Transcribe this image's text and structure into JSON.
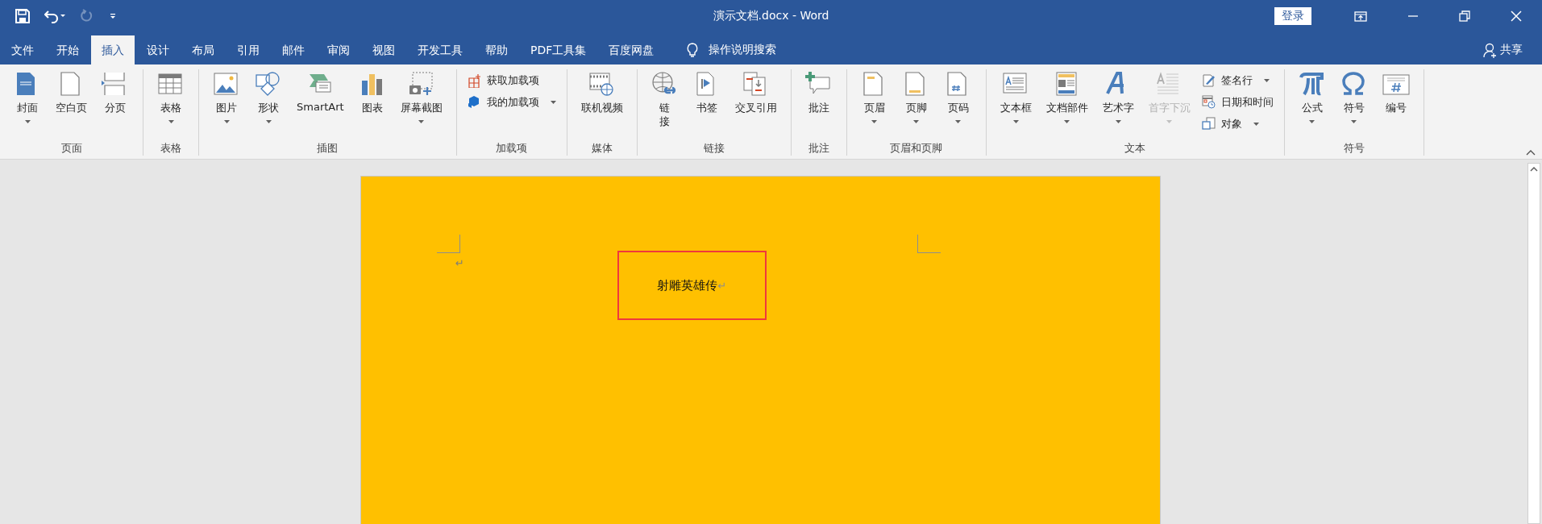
{
  "window": {
    "title": "演示文档.docx  -  Word",
    "sign_in": "登录"
  },
  "quick_access": [
    {
      "kind": "save",
      "disabled": false
    },
    {
      "kind": "undo",
      "disabled": false
    },
    {
      "kind": "redo",
      "disabled": true
    },
    {
      "kind": "customize",
      "disabled": false
    }
  ],
  "tabs": [
    {
      "label": "文件",
      "selected": false
    },
    {
      "label": "开始",
      "selected": false
    },
    {
      "label": "插入",
      "selected": true
    },
    {
      "label": "设计",
      "selected": false
    },
    {
      "label": "布局",
      "selected": false
    },
    {
      "label": "引用",
      "selected": false
    },
    {
      "label": "邮件",
      "selected": false
    },
    {
      "label": "审阅",
      "selected": false
    },
    {
      "label": "视图",
      "selected": false
    },
    {
      "label": "开发工具",
      "selected": false
    },
    {
      "label": "帮助",
      "selected": false
    },
    {
      "label": "PDF工具集",
      "selected": false
    },
    {
      "label": "百度网盘",
      "selected": false
    }
  ],
  "tell_me": "操作说明搜索",
  "share": "共享",
  "ribbon_groups": [
    {
      "label": "页面",
      "buttons": [
        {
          "label": "封面",
          "kind": "large",
          "dropdown": true,
          "disabled": false
        },
        {
          "label": "空白页",
          "kind": "large",
          "dropdown": false,
          "disabled": false
        },
        {
          "label": "分页",
          "kind": "large",
          "dropdown": false,
          "disabled": false
        }
      ]
    },
    {
      "label": "表格",
      "buttons": [
        {
          "label": "表格",
          "kind": "large",
          "dropdown": true,
          "disabled": false
        }
      ]
    },
    {
      "label": "插图",
      "buttons": [
        {
          "label": "图片",
          "kind": "large",
          "dropdown": true,
          "disabled": false
        },
        {
          "label": "形状",
          "kind": "large",
          "dropdown": true,
          "disabled": false
        },
        {
          "label": "SmartArt",
          "kind": "large",
          "dropdown": false,
          "disabled": false
        },
        {
          "label": "图表",
          "kind": "large",
          "dropdown": false,
          "disabled": false
        },
        {
          "label": "屏幕截图",
          "kind": "large",
          "dropdown": true,
          "disabled": false
        }
      ]
    },
    {
      "label": "加载项",
      "buttons": [
        {
          "label": "获取加载项",
          "kind": "small",
          "dropdown": false,
          "disabled": false
        },
        {
          "label": "我的加载项",
          "kind": "small",
          "dropdown": true,
          "disabled": false
        }
      ]
    },
    {
      "label": "媒体",
      "buttons": [
        {
          "label": "联机视频",
          "kind": "large",
          "dropdown": false,
          "disabled": false
        }
      ]
    },
    {
      "label": "链接",
      "buttons": [
        {
          "label": "链接",
          "kind": "tall",
          "dropdown": false,
          "disabled": false
        },
        {
          "label": "书签",
          "kind": "large",
          "dropdown": false,
          "disabled": false
        },
        {
          "label": "交叉引用",
          "kind": "large",
          "dropdown": false,
          "disabled": false
        }
      ]
    },
    {
      "label": "批注",
      "buttons": [
        {
          "label": "批注",
          "kind": "large",
          "dropdown": false,
          "disabled": false
        }
      ]
    },
    {
      "label": "页眉和页脚",
      "buttons": [
        {
          "label": "页眉",
          "kind": "large",
          "dropdown": true,
          "disabled": false
        },
        {
          "label": "页脚",
          "kind": "large",
          "dropdown": true,
          "disabled": false
        },
        {
          "label": "页码",
          "kind": "large",
          "dropdown": true,
          "disabled": false
        }
      ]
    },
    {
      "label": "文本",
      "buttons": [
        {
          "label": "文本框",
          "kind": "large",
          "dropdown": true,
          "disabled": false
        },
        {
          "label": "文档部件",
          "kind": "large",
          "dropdown": true,
          "disabled": false
        },
        {
          "label": "艺术字",
          "kind": "large",
          "dropdown": true,
          "disabled": false
        },
        {
          "label": "首字下沉",
          "kind": "large",
          "dropdown": true,
          "disabled": true
        },
        {
          "label": "签名行",
          "kind": "small",
          "dropdown": true,
          "disabled": false
        },
        {
          "label": "日期和时间",
          "kind": "small",
          "dropdown": false,
          "disabled": false
        },
        {
          "label": "对象",
          "kind": "small",
          "dropdown": true,
          "disabled": false
        }
      ]
    },
    {
      "label": "符号",
      "buttons": [
        {
          "label": "公式",
          "kind": "large",
          "dropdown": true,
          "disabled": false
        },
        {
          "label": "符号",
          "kind": "large",
          "dropdown": true,
          "disabled": false
        },
        {
          "label": "编号",
          "kind": "large",
          "dropdown": false,
          "disabled": false
        }
      ]
    }
  ],
  "document": {
    "empty_paragraph_mark": "↵",
    "text_box": {
      "text": "射雕英雄传",
      "paragraph_mark": "↵"
    }
  }
}
